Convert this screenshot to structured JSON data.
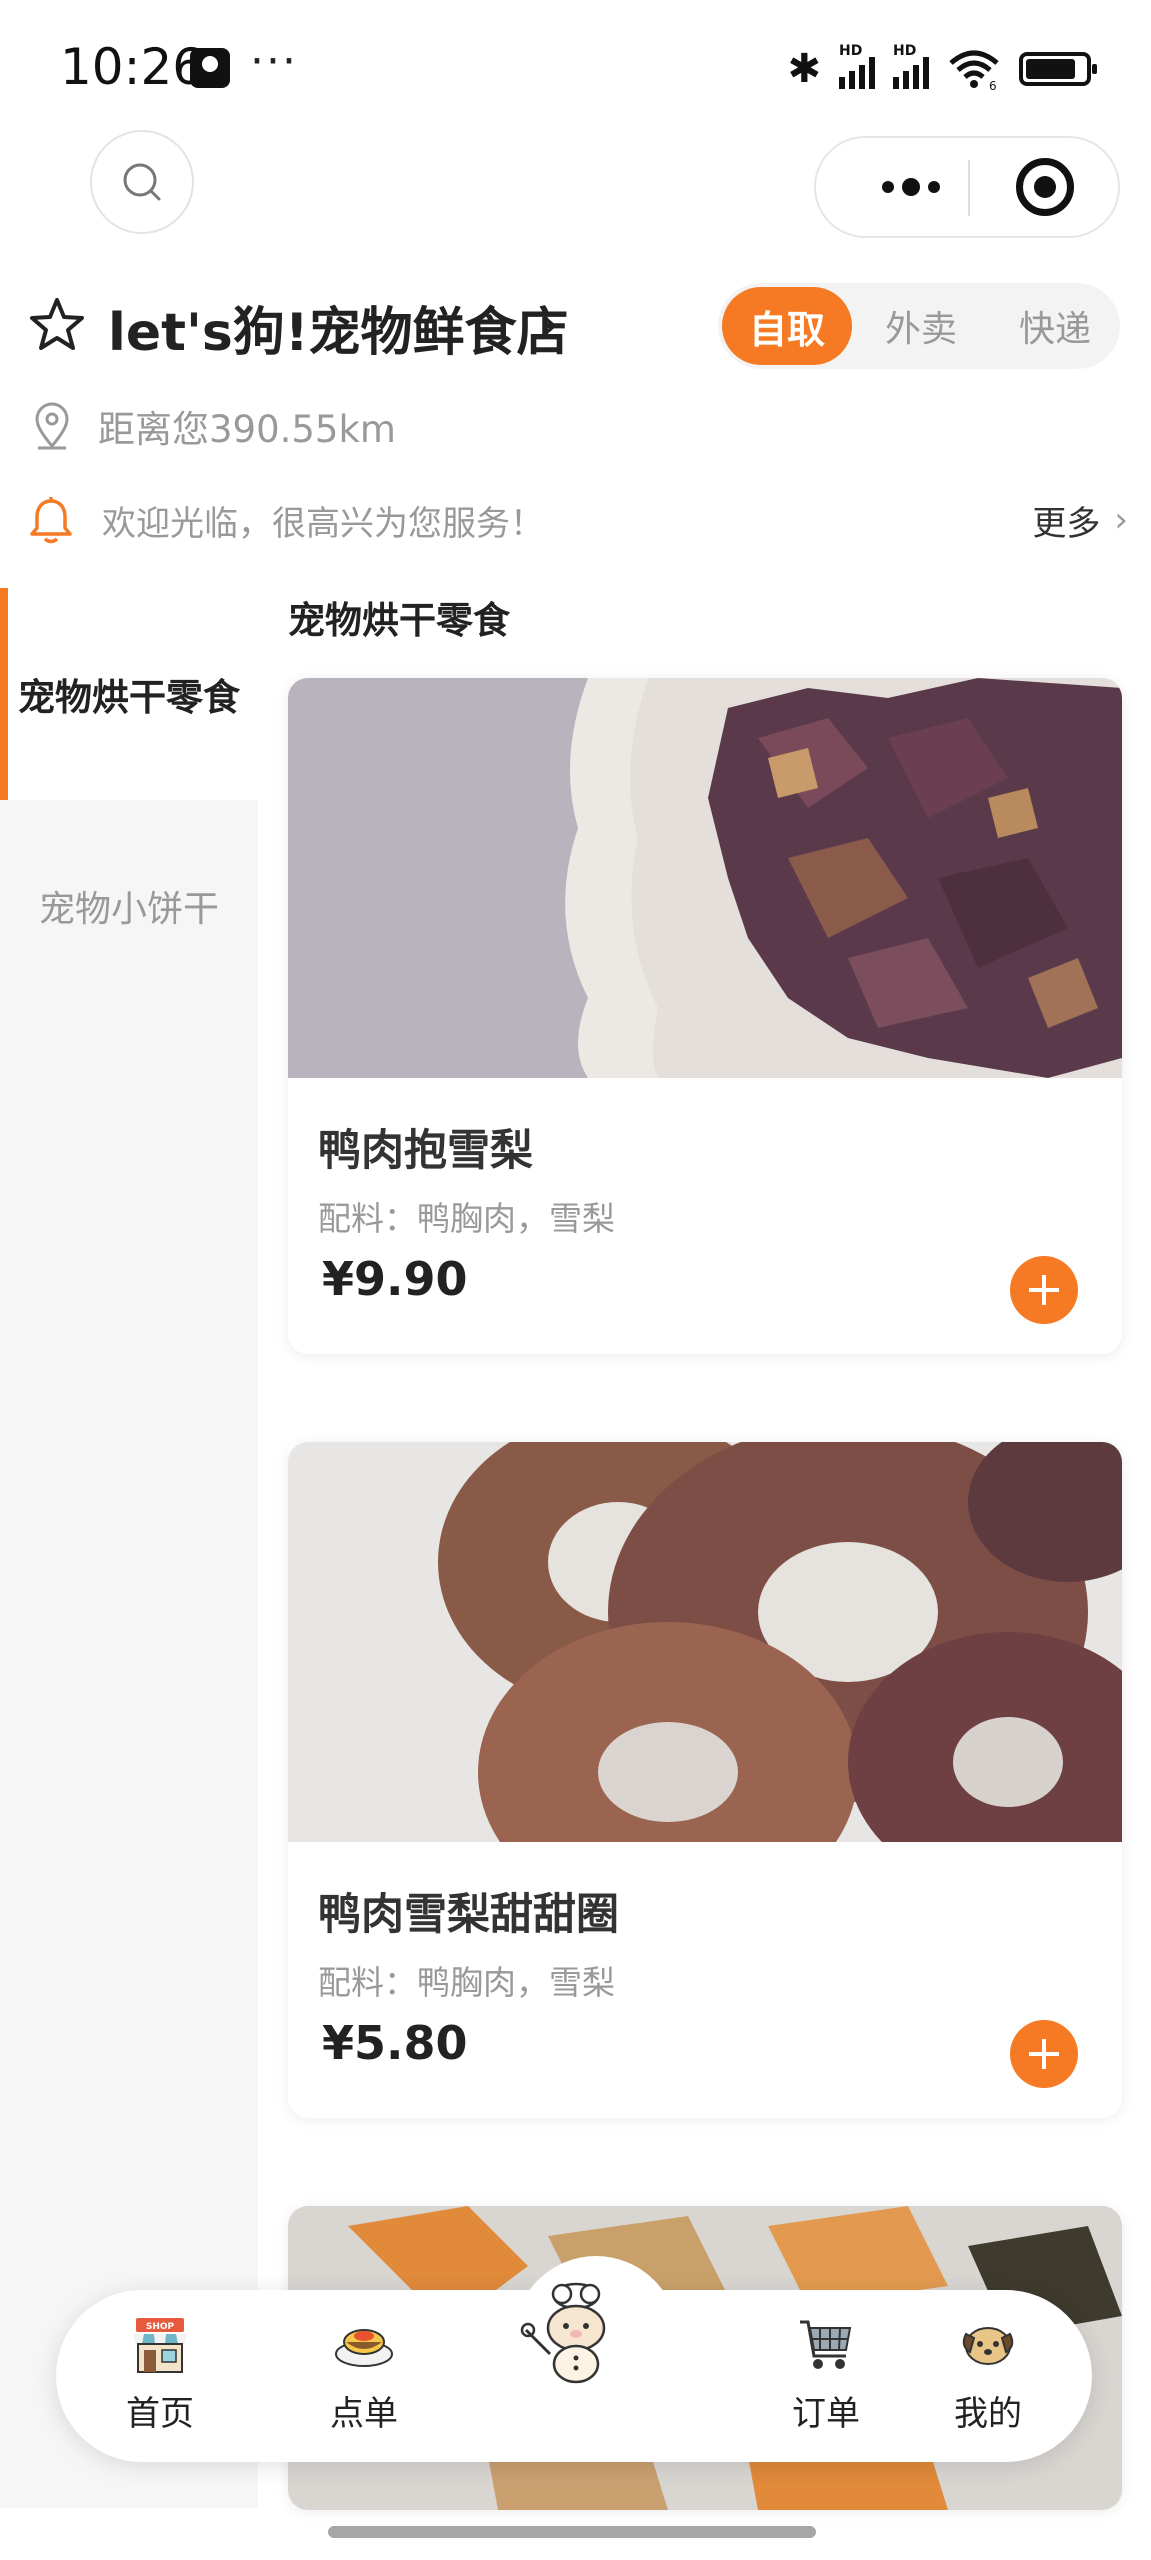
{
  "status_bar": {
    "time": "10:26",
    "more": "···",
    "hd1": "HD",
    "hd2": "HD",
    "wifi_badge": "6"
  },
  "store": {
    "name": "let's狗!宠物鲜食店",
    "distance": "距离您390.55km",
    "notice": "欢迎光临，很高兴为您服务！",
    "notice_more": "更多"
  },
  "modes": [
    {
      "label": "自取",
      "active": true
    },
    {
      "label": "外卖",
      "active": false
    },
    {
      "label": "快递",
      "active": false
    }
  ],
  "sidebar": {
    "items": [
      {
        "label": "宠物烘干零食",
        "active": true
      },
      {
        "label": "宠物小饼干",
        "active": false
      }
    ]
  },
  "section_title": "宠物烘干零食",
  "products": [
    {
      "name": "鸭肉抱雪梨",
      "ingredients": "配料：鸭胸肉，雪梨",
      "price": "¥9.90"
    },
    {
      "name": "鸭肉雪梨甜甜圈",
      "ingredients": "配料：鸭胸肉，雪梨",
      "price": "¥5.80"
    }
  ],
  "tabbar": {
    "items": [
      {
        "label": "首页",
        "icon": "shop-icon"
      },
      {
        "label": "点单",
        "icon": "food-plate-icon"
      },
      {
        "label": "",
        "icon": "mascot-chef-bear-icon"
      },
      {
        "label": "订单",
        "icon": "shopping-cart-icon"
      },
      {
        "label": "我的",
        "icon": "dog-face-icon"
      }
    ]
  },
  "colors": {
    "accent": "#f57a23",
    "muted_text": "#999999",
    "sidebar_bg": "#f6f6f6"
  }
}
